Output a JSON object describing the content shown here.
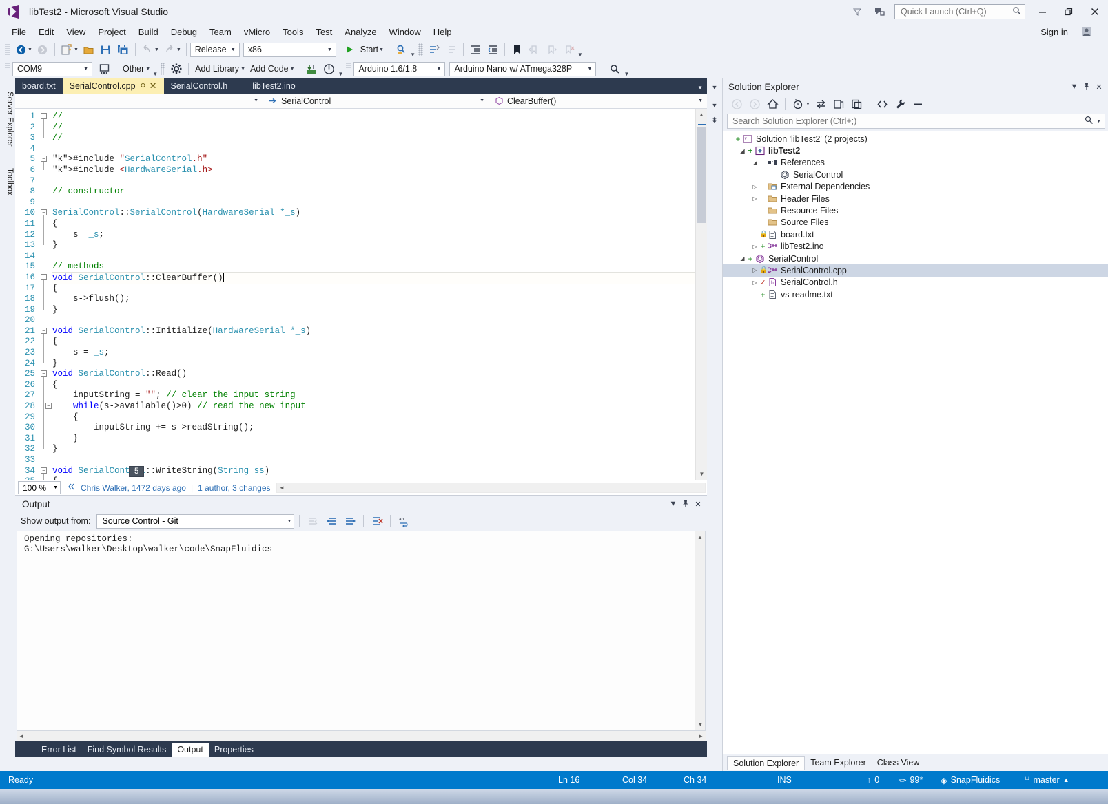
{
  "window": {
    "title": "libTest2 - Microsoft Visual Studio",
    "sign_in": "Sign in",
    "quick_launch_placeholder": "Quick Launch (Ctrl+Q)"
  },
  "menu": [
    "File",
    "Edit",
    "View",
    "Project",
    "Build",
    "Debug",
    "Team",
    "vMicro",
    "Tools",
    "Test",
    "Analyze",
    "Window",
    "Help"
  ],
  "toolbar1": {
    "config": "Release",
    "platform": "x86",
    "start": "Start"
  },
  "toolbar2": {
    "port": "COM9",
    "other": "Other",
    "add_library": "Add Library",
    "add_code": "Add Code",
    "ide_version": "Arduino 1.6/1.8",
    "board": "Arduino Nano w/ ATmega328P"
  },
  "editor": {
    "tabs": [
      {
        "label": "board.txt",
        "active": false
      },
      {
        "label": "SerialControl.cpp",
        "active": true
      },
      {
        "label": "SerialControl.h",
        "active": false
      },
      {
        "label": "libTest2.ino",
        "active": false
      }
    ],
    "nav_project": "",
    "nav_class": "SerialControl",
    "nav_member": "ClearBuffer()",
    "zoom": "100 %",
    "codelens_author": "Chris Walker, 1472 days ago",
    "codelens_changes": "1 author, 3 changes",
    "tooltip_count": "5",
    "lines": [
      {
        "n": "1",
        "code": "//"
      },
      {
        "n": "2",
        "code": "//"
      },
      {
        "n": "3",
        "code": "//"
      },
      {
        "n": "4",
        "code": ""
      },
      {
        "n": "5",
        "code": "#include \"SerialControl.h\""
      },
      {
        "n": "6",
        "code": "#include <HardwareSerial.h>"
      },
      {
        "n": "7",
        "code": ""
      },
      {
        "n": "8",
        "code": "// constructor"
      },
      {
        "n": "9",
        "code": ""
      },
      {
        "n": "10",
        "code": "SerialControl::SerialControl(HardwareSerial *_s)"
      },
      {
        "n": "11",
        "code": "{"
      },
      {
        "n": "12",
        "code": "    s =_s;"
      },
      {
        "n": "13",
        "code": "}"
      },
      {
        "n": "14",
        "code": ""
      },
      {
        "n": "15",
        "code": "// methods"
      },
      {
        "n": "16",
        "code": "void SerialControl::ClearBuffer()"
      },
      {
        "n": "17",
        "code": "{"
      },
      {
        "n": "18",
        "code": "    s->flush();"
      },
      {
        "n": "19",
        "code": "}"
      },
      {
        "n": "20",
        "code": ""
      },
      {
        "n": "21",
        "code": "void SerialControl::Initialize(HardwareSerial *_s)"
      },
      {
        "n": "22",
        "code": "{"
      },
      {
        "n": "23",
        "code": "    s = _s;"
      },
      {
        "n": "24",
        "code": "}"
      },
      {
        "n": "25",
        "code": "void SerialControl::Read()"
      },
      {
        "n": "26",
        "code": "{"
      },
      {
        "n": "27",
        "code": "    inputString = \"\"; // clear the input string"
      },
      {
        "n": "28",
        "code": "    while(s->available()>0) // read the new input"
      },
      {
        "n": "29",
        "code": "    {"
      },
      {
        "n": "30",
        "code": "        inputString += s->readString();"
      },
      {
        "n": "31",
        "code": "    }"
      },
      {
        "n": "32",
        "code": "}"
      },
      {
        "n": "33",
        "code": ""
      },
      {
        "n": "34",
        "code": "void SerialControl::WriteString(String ss)"
      },
      {
        "n": "35",
        "code": "{"
      }
    ]
  },
  "solution_explorer": {
    "title": "Solution Explorer",
    "search_placeholder": "Search Solution Explorer (Ctrl+;)",
    "tree": [
      {
        "label": "Solution 'libTest2' (2 projects)",
        "depth": 0,
        "icon": "solution-icon",
        "expander": "",
        "plus": true,
        "bold": false,
        "selected": false
      },
      {
        "label": "libTest2",
        "depth": 1,
        "icon": "project-icon",
        "expander": "open",
        "plus": true,
        "bold": true,
        "selected": false
      },
      {
        "label": "References",
        "depth": 2,
        "icon": "references-icon",
        "expander": "open",
        "plus": false,
        "bold": false,
        "selected": false
      },
      {
        "label": "SerialControl",
        "depth": 3,
        "icon": "reference-item-icon",
        "expander": "",
        "plus": false,
        "bold": false,
        "selected": false
      },
      {
        "label": "External Dependencies",
        "depth": 2,
        "icon": "folder-dep-icon",
        "expander": "closed",
        "plus": false,
        "bold": false,
        "selected": false
      },
      {
        "label": "Header Files",
        "depth": 2,
        "icon": "folder-icon",
        "expander": "closed",
        "plus": false,
        "bold": false,
        "selected": false
      },
      {
        "label": "Resource Files",
        "depth": 2,
        "icon": "folder-icon",
        "expander": "",
        "plus": false,
        "bold": false,
        "selected": false
      },
      {
        "label": "Source Files",
        "depth": 2,
        "icon": "folder-icon",
        "expander": "",
        "plus": false,
        "bold": false,
        "selected": false
      },
      {
        "label": "board.txt",
        "depth": 2,
        "icon": "text-file-icon",
        "expander": "",
        "plus": false,
        "lock": true,
        "bold": false,
        "selected": false
      },
      {
        "label": "libTest2.ino",
        "depth": 2,
        "icon": "cpp-file-icon",
        "expander": "closed",
        "plus": true,
        "bold": false,
        "selected": false
      },
      {
        "label": "SerialControl",
        "depth": 1,
        "icon": "lib-project-icon",
        "expander": "open",
        "plus": true,
        "bold": false,
        "selected": false
      },
      {
        "label": "SerialControl.cpp",
        "depth": 2,
        "icon": "cpp-file-icon",
        "expander": "closed",
        "plus": false,
        "lock": true,
        "bold": false,
        "selected": true
      },
      {
        "label": "SerialControl.h",
        "depth": 2,
        "icon": "h-file-icon",
        "expander": "closed",
        "plus": false,
        "check": true,
        "bold": false,
        "selected": false
      },
      {
        "label": "vs-readme.txt",
        "depth": 2,
        "icon": "text-file-icon",
        "expander": "",
        "plus": true,
        "bold": false,
        "selected": false
      }
    ],
    "tabs": [
      {
        "label": "Solution Explorer",
        "active": true
      },
      {
        "label": "Team Explorer",
        "active": false
      },
      {
        "label": "Class View",
        "active": false
      }
    ]
  },
  "output": {
    "title": "Output",
    "source_label": "Show output from:",
    "source_value": "Source Control - Git",
    "text": "Opening repositories:\nG:\\Users\\walker\\Desktop\\walker\\code\\SnapFluidics"
  },
  "bottom_tabs": [
    {
      "label": "Error List",
      "active": false
    },
    {
      "label": "Find Symbol Results",
      "active": false
    },
    {
      "label": "Output",
      "active": true
    },
    {
      "label": "Properties",
      "active": false
    }
  ],
  "status_bar": {
    "ready": "Ready",
    "line": "Ln 16",
    "col": "Col 34",
    "ch": "Ch 34",
    "ins": "INS",
    "up_count": "0",
    "pencil_count": "99*",
    "repo": "SnapFluidics",
    "branch": "master"
  },
  "rails": {
    "server_explorer": "Server Explorer",
    "toolbox": "Toolbox"
  },
  "colors": {
    "accent": "#007acc",
    "title_bar": "#eef1f7",
    "tab_strip": "#2d3a4f",
    "active_tab": "#fcefb3"
  }
}
